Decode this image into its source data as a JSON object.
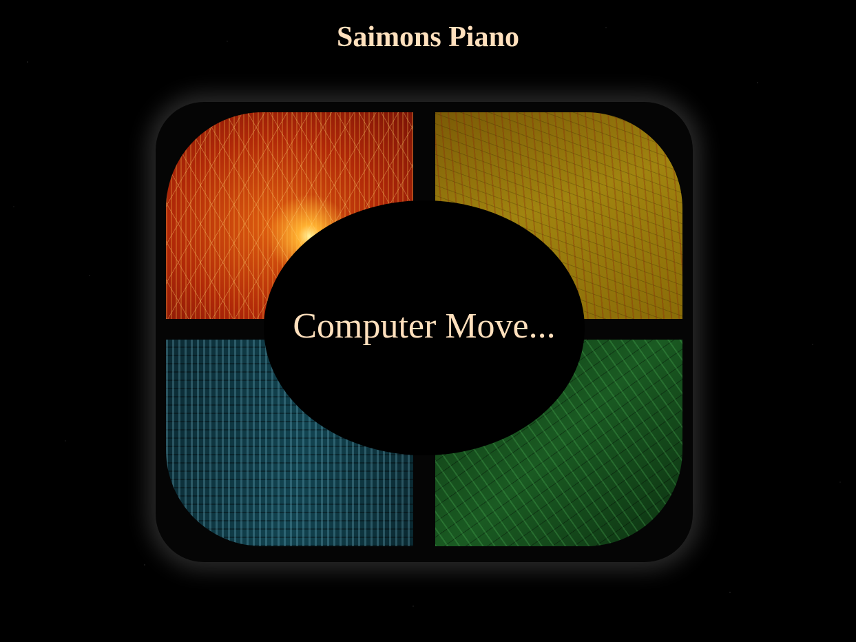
{
  "page": {
    "title": "Saimons Piano"
  },
  "game": {
    "status": "Computer Move...",
    "pads": [
      {
        "color_name": "red",
        "color": "#c8380a"
      },
      {
        "color_name": "yellow",
        "color": "#a08410"
      },
      {
        "color_name": "blue",
        "color": "#124451"
      },
      {
        "color_name": "green",
        "color": "#1a5a22"
      }
    ]
  },
  "colors": {
    "title_text": "#ffe0bd",
    "background": "#000000",
    "board": "#050505"
  }
}
